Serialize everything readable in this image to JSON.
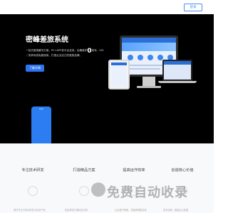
{
  "header": {
    "login_label": "登录"
  },
  "hero": {
    "title": "密峰差旅系统",
    "desc_part1": "一站式差旅解决方案，PC+APP多平台支持，后期维护",
    "desc_big": "0",
    "desc_part2": "成本，IOS／安卓系统免费使用，打造企业自己的差旅品牌。",
    "cta_label": "了解详情"
  },
  "features": [
    {
      "title": "专注技术研发",
      "desc": "我们专注于技术研发与技术产品"
    },
    {
      "title": "打造精品方案",
      "desc": "精益求精打造精品方案"
    },
    {
      "title": "提高运作效率",
      "desc": "让出差不再难，流程透明更高效"
    },
    {
      "title": "创造核心价值",
      "desc": "技术创新，赋能企业发展"
    }
  ],
  "watermark": {
    "text": "免费自动收录"
  },
  "colors": {
    "accent": "#2e74f0",
    "hero_bg": "#000000"
  }
}
